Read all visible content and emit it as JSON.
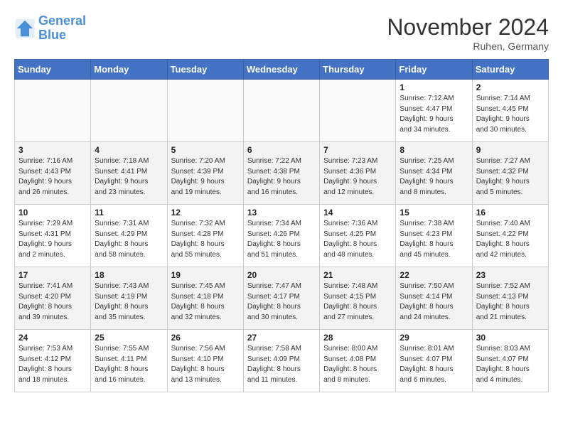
{
  "header": {
    "logo_line1": "General",
    "logo_line2": "Blue",
    "month_title": "November 2024",
    "location": "Ruhen, Germany"
  },
  "weekdays": [
    "Sunday",
    "Monday",
    "Tuesday",
    "Wednesday",
    "Thursday",
    "Friday",
    "Saturday"
  ],
  "weeks": [
    [
      {
        "day": "",
        "info": ""
      },
      {
        "day": "",
        "info": ""
      },
      {
        "day": "",
        "info": ""
      },
      {
        "day": "",
        "info": ""
      },
      {
        "day": "",
        "info": ""
      },
      {
        "day": "1",
        "info": "Sunrise: 7:12 AM\nSunset: 4:47 PM\nDaylight: 9 hours\nand 34 minutes."
      },
      {
        "day": "2",
        "info": "Sunrise: 7:14 AM\nSunset: 4:45 PM\nDaylight: 9 hours\nand 30 minutes."
      }
    ],
    [
      {
        "day": "3",
        "info": "Sunrise: 7:16 AM\nSunset: 4:43 PM\nDaylight: 9 hours\nand 26 minutes."
      },
      {
        "day": "4",
        "info": "Sunrise: 7:18 AM\nSunset: 4:41 PM\nDaylight: 9 hours\nand 23 minutes."
      },
      {
        "day": "5",
        "info": "Sunrise: 7:20 AM\nSunset: 4:39 PM\nDaylight: 9 hours\nand 19 minutes."
      },
      {
        "day": "6",
        "info": "Sunrise: 7:22 AM\nSunset: 4:38 PM\nDaylight: 9 hours\nand 16 minutes."
      },
      {
        "day": "7",
        "info": "Sunrise: 7:23 AM\nSunset: 4:36 PM\nDaylight: 9 hours\nand 12 minutes."
      },
      {
        "day": "8",
        "info": "Sunrise: 7:25 AM\nSunset: 4:34 PM\nDaylight: 9 hours\nand 8 minutes."
      },
      {
        "day": "9",
        "info": "Sunrise: 7:27 AM\nSunset: 4:32 PM\nDaylight: 9 hours\nand 5 minutes."
      }
    ],
    [
      {
        "day": "10",
        "info": "Sunrise: 7:29 AM\nSunset: 4:31 PM\nDaylight: 9 hours\nand 2 minutes."
      },
      {
        "day": "11",
        "info": "Sunrise: 7:31 AM\nSunset: 4:29 PM\nDaylight: 8 hours\nand 58 minutes."
      },
      {
        "day": "12",
        "info": "Sunrise: 7:32 AM\nSunset: 4:28 PM\nDaylight: 8 hours\nand 55 minutes."
      },
      {
        "day": "13",
        "info": "Sunrise: 7:34 AM\nSunset: 4:26 PM\nDaylight: 8 hours\nand 51 minutes."
      },
      {
        "day": "14",
        "info": "Sunrise: 7:36 AM\nSunset: 4:25 PM\nDaylight: 8 hours\nand 48 minutes."
      },
      {
        "day": "15",
        "info": "Sunrise: 7:38 AM\nSunset: 4:23 PM\nDaylight: 8 hours\nand 45 minutes."
      },
      {
        "day": "16",
        "info": "Sunrise: 7:40 AM\nSunset: 4:22 PM\nDaylight: 8 hours\nand 42 minutes."
      }
    ],
    [
      {
        "day": "17",
        "info": "Sunrise: 7:41 AM\nSunset: 4:20 PM\nDaylight: 8 hours\nand 39 minutes."
      },
      {
        "day": "18",
        "info": "Sunrise: 7:43 AM\nSunset: 4:19 PM\nDaylight: 8 hours\nand 35 minutes."
      },
      {
        "day": "19",
        "info": "Sunrise: 7:45 AM\nSunset: 4:18 PM\nDaylight: 8 hours\nand 32 minutes."
      },
      {
        "day": "20",
        "info": "Sunrise: 7:47 AM\nSunset: 4:17 PM\nDaylight: 8 hours\nand 30 minutes."
      },
      {
        "day": "21",
        "info": "Sunrise: 7:48 AM\nSunset: 4:15 PM\nDaylight: 8 hours\nand 27 minutes."
      },
      {
        "day": "22",
        "info": "Sunrise: 7:50 AM\nSunset: 4:14 PM\nDaylight: 8 hours\nand 24 minutes."
      },
      {
        "day": "23",
        "info": "Sunrise: 7:52 AM\nSunset: 4:13 PM\nDaylight: 8 hours\nand 21 minutes."
      }
    ],
    [
      {
        "day": "24",
        "info": "Sunrise: 7:53 AM\nSunset: 4:12 PM\nDaylight: 8 hours\nand 18 minutes."
      },
      {
        "day": "25",
        "info": "Sunrise: 7:55 AM\nSunset: 4:11 PM\nDaylight: 8 hours\nand 16 minutes."
      },
      {
        "day": "26",
        "info": "Sunrise: 7:56 AM\nSunset: 4:10 PM\nDaylight: 8 hours\nand 13 minutes."
      },
      {
        "day": "27",
        "info": "Sunrise: 7:58 AM\nSunset: 4:09 PM\nDaylight: 8 hours\nand 11 minutes."
      },
      {
        "day": "28",
        "info": "Sunrise: 8:00 AM\nSunset: 4:08 PM\nDaylight: 8 hours\nand 8 minutes."
      },
      {
        "day": "29",
        "info": "Sunrise: 8:01 AM\nSunset: 4:07 PM\nDaylight: 8 hours\nand 6 minutes."
      },
      {
        "day": "30",
        "info": "Sunrise: 8:03 AM\nSunset: 4:07 PM\nDaylight: 8 hours\nand 4 minutes."
      }
    ]
  ]
}
